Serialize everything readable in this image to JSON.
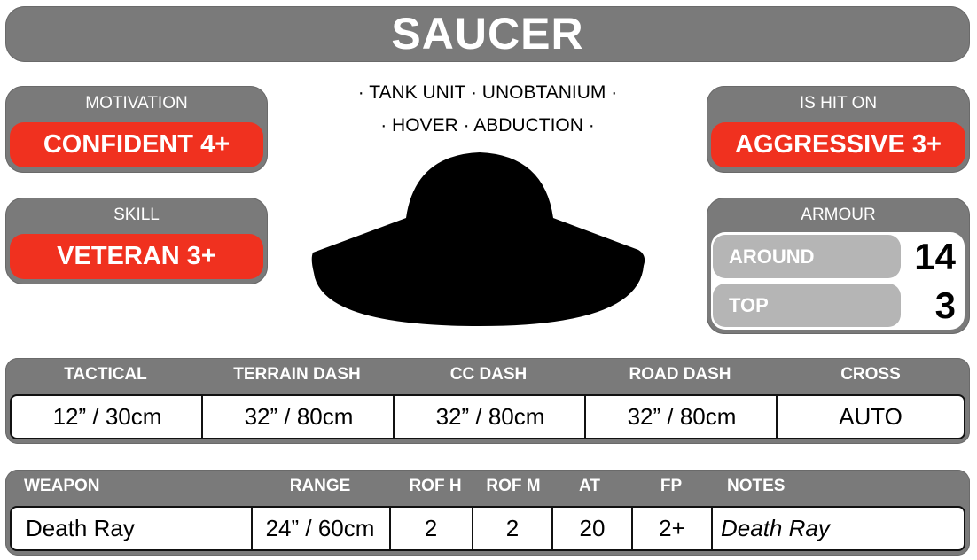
{
  "title": "SAUCER",
  "motivation": {
    "label": "MOTIVATION",
    "value": "CONFIDENT 4+"
  },
  "skill": {
    "label": "SKILL",
    "value": "VETERAN 3+"
  },
  "is_hit_on": {
    "label": "IS HIT ON",
    "value": "AGGRESSIVE 3+"
  },
  "keywords": {
    "line1": "· TANK UNIT · UNOBTANIUM ·",
    "line2": "· HOVER · ABDUCTION ·"
  },
  "unit_image_icon": "saucer-silhouette-icon",
  "armour": {
    "label": "ARMOUR",
    "rows": [
      {
        "label": "AROUND",
        "value": "14"
      },
      {
        "label": "TOP",
        "value": "3"
      }
    ]
  },
  "movement": {
    "headers": [
      "TACTICAL",
      "TERRAIN DASH",
      "CC DASH",
      "ROAD DASH",
      "CROSS"
    ],
    "values": [
      "12” / 30cm",
      "32” / 80cm",
      "32” / 80cm",
      "32” / 80cm",
      "AUTO"
    ]
  },
  "weapons": {
    "headers": [
      "WEAPON",
      "RANGE",
      "ROF H",
      "ROF M",
      "AT",
      "FP",
      "NOTES"
    ],
    "rows": [
      [
        "Death Ray",
        "24” / 60cm",
        "2",
        "2",
        "20",
        "2+",
        "Death Ray"
      ]
    ]
  },
  "colors": {
    "panel_gray": "#7a7a7a",
    "value_red": "#f0311f",
    "armour_label_gray": "#b5b5b5"
  }
}
